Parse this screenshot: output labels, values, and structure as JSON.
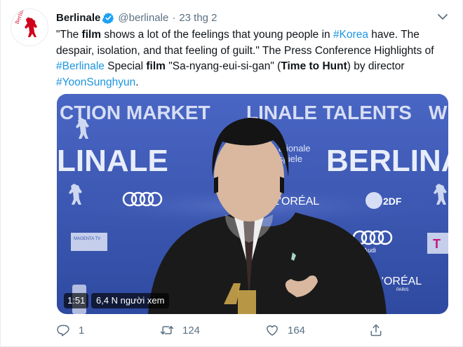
{
  "tweet": {
    "author_name": "Berlinale",
    "handle": "@berlinale",
    "separator": "·",
    "date": "23 thg 2",
    "text": {
      "p1": "\"The ",
      "w_film1": "film",
      "p2": " shows a lot of the feelings that young people in ",
      "tag_korea": "#Korea",
      "p3": " have. The despair, isolation, and that feeling of guilt.\" The Press Conference Highlights of ",
      "tag_berlinale": "#Berlinale",
      "p4": " Special ",
      "w_film2": "film",
      "p5": " \"Sa-nyang-eui-si-gan\" (",
      "w_title": "Time to Hunt",
      "p6": ") by director ",
      "tag_director": "#YoonSunghyun",
      "p7": "."
    }
  },
  "video": {
    "duration": "1:51",
    "viewers": "6,4 N người xem",
    "backdrop": {
      "line1_left": "CTION MARKET",
      "line1_mid": "LINALE TALENTS",
      "line1_right": "WI",
      "line2_left": "LINALE",
      "line2_right": "BERLINA",
      "sponsor_mid_1": "ationale",
      "sponsor_mid_2": "spiele",
      "audi_word": "Audi",
      "loreal": "L'ORÉAL",
      "loreal_sub": "PARIS",
      "zdf": "2DF",
      "magenta": "MAGENTA TV",
      "telekom": "T"
    }
  },
  "actions": {
    "replies": "1",
    "retweets": "124",
    "likes": "164"
  },
  "colors": {
    "link": "#1b95e0",
    "muted": "#5b7083",
    "verified": "#1da1f2",
    "brand_red": "#d0021b",
    "backdrop_blue": "#3a56b0"
  },
  "icons": [
    "berlinale-bear-logo",
    "verified-badge-icon",
    "chevron-down-icon",
    "reply-icon",
    "retweet-icon",
    "like-icon",
    "share-icon"
  ]
}
